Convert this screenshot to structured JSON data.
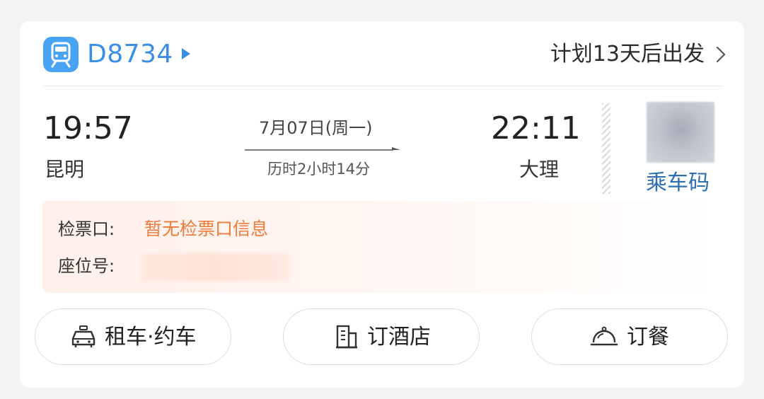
{
  "header": {
    "train_number": "D8734",
    "plan_text": "计划13天后出发"
  },
  "journey": {
    "departure_time": "19:57",
    "departure_station": "昆明",
    "date": "7月07日(周一)",
    "duration": "历时2小时14分",
    "arrival_time": "22:11",
    "arrival_station": "大理"
  },
  "boarding_code": {
    "label": "乘车码"
  },
  "info": {
    "gate_label": "检票口:",
    "gate_value": "暂无检票口信息",
    "seat_label": "座位号:"
  },
  "actions": {
    "taxi": "租车·约车",
    "hotel": "订酒店",
    "meal": "订餐"
  },
  "colors": {
    "accent": "#3a8ee6",
    "badge": "#48a3f5",
    "warning": "#f07a3a",
    "code_label": "#2e6fb0"
  },
  "icons": [
    "train-icon",
    "play-arrow-icon",
    "chevron-right-icon",
    "journey-arrow-icon",
    "taxi-icon",
    "hotel-icon",
    "meal-cloche-icon"
  ]
}
